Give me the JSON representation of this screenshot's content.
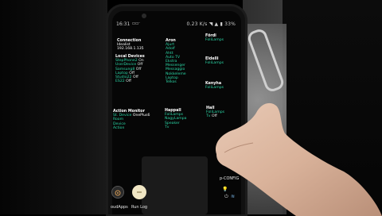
{
  "status": {
    "time": "16:31",
    "network": "0.23 K/s",
    "battery": "33%"
  },
  "columns": {
    "connection": {
      "title": "Connection",
      "lines": [
        "Idealist",
        "192.168.1.135"
      ]
    },
    "local_devices": {
      "title": "Local Devices",
      "items": [
        {
          "name": "StepPhone2",
          "state": "On"
        },
        {
          "name": "UserDevice",
          "state": "Off"
        },
        {
          "name": "Samsung8",
          "state": "Off"
        },
        {
          "name": "Laptop",
          "state": "Off"
        },
        {
          "name": "Studio22",
          "state": "Off"
        },
        {
          "name": "ES22",
          "state": "Off"
        }
      ]
    },
    "aron": {
      "title": "Aron",
      "items": [
        "Ajurt",
        "Adolf",
        "Ahtt",
        "Auto TV",
        "Ekstra",
        "Messenger",
        "Messaggio",
        "Nokkeleme",
        "Laptop",
        "Telkos"
      ]
    },
    "fordi": {
      "title": "Fördi",
      "items": [
        "FoliLamps"
      ]
    },
    "eldelli": {
      "title": "Eldelli",
      "items": [
        "FoliLamps"
      ]
    },
    "kenyha": {
      "title": "Kenyha",
      "items": [
        "FoliLamps"
      ]
    },
    "action_monitor": {
      "title": "Action Monitor",
      "items": [
        "St. Device",
        "Room",
        "Device",
        "Action"
      ],
      "device_value": "OnePlus6"
    },
    "happall": {
      "title": "Happall",
      "items": [
        "FoliLamps",
        "NagyLampa",
        "Speaker",
        "Tv"
      ]
    },
    "hall": {
      "title": "Hall",
      "items": [
        "FoliLamps",
        "Tv"
      ],
      "tv_state": "Off"
    }
  },
  "dock": {
    "left_label": "oudApps",
    "center_label": "Run Log",
    "right_label": "p-CONFIG"
  }
}
